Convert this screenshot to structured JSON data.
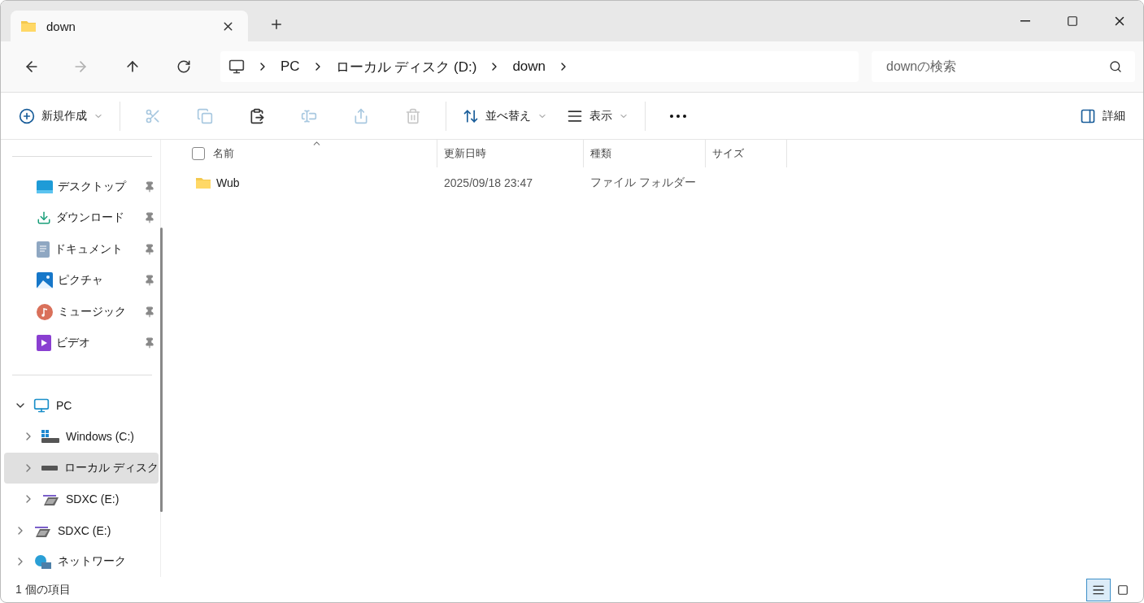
{
  "tabs": [
    {
      "label": "down",
      "selected": true
    }
  ],
  "nav": {
    "back_disabled": false,
    "forward_disabled": true
  },
  "breadcrumb": [
    "PC",
    "ローカル ディスク (D:)",
    "down"
  ],
  "search": {
    "placeholder": "downの検索"
  },
  "toolbar": [
    {
      "kind": "new",
      "label": "新規作成",
      "disabled": false
    },
    {
      "kind": "cut",
      "disabled": true
    },
    {
      "kind": "copy",
      "disabled": true
    },
    {
      "kind": "paste",
      "disabled": false
    },
    {
      "kind": "rename",
      "disabled": true
    },
    {
      "kind": "share",
      "disabled": true
    },
    {
      "kind": "delete",
      "disabled": true
    },
    {
      "kind": "sort",
      "label": "並べ替え",
      "disabled": false
    },
    {
      "kind": "view",
      "label": "表示",
      "disabled": false
    },
    {
      "kind": "more",
      "disabled": false
    }
  ],
  "details_button": {
    "label": "詳細"
  },
  "quick_access": [
    {
      "kind": "desktop",
      "label": "デスクトップ",
      "pinned": true
    },
    {
      "kind": "download",
      "label": "ダウンロード",
      "pinned": true
    },
    {
      "kind": "document",
      "label": "ドキュメント",
      "pinned": true
    },
    {
      "kind": "picture",
      "label": "ピクチャ",
      "pinned": true
    },
    {
      "kind": "music",
      "label": "ミュージック",
      "pinned": true
    },
    {
      "kind": "video",
      "label": "ビデオ",
      "pinned": true
    }
  ],
  "tree": [
    {
      "kind": "pc",
      "label": "PC",
      "expanded": true,
      "selected": false,
      "children": [
        {
          "kind": "windows-drive",
          "label": "Windows (C:)",
          "expanded": false,
          "selected": false
        },
        {
          "kind": "drive",
          "label": "ローカル ディスク",
          "expanded": false,
          "selected": true
        },
        {
          "kind": "sd-card",
          "label": "SDXC (E:)",
          "expanded": false,
          "selected": false
        }
      ]
    },
    {
      "kind": "sd-card",
      "label": "SDXC (E:)",
      "expanded": false,
      "selected": false
    },
    {
      "kind": "network",
      "label": "ネットワーク",
      "expanded": false,
      "selected": false
    }
  ],
  "select_all": {
    "checked": false
  },
  "columns": [
    {
      "label": "名前",
      "sorted": true
    },
    {
      "label": "更新日時",
      "sorted": false
    },
    {
      "label": "種類",
      "sorted": false
    },
    {
      "label": "サイズ",
      "sorted": false
    }
  ],
  "rows": [
    {
      "name": "Wub",
      "modified": "2025/09/18 23:47",
      "type": "ファイル フォルダー",
      "selected": false
    }
  ],
  "status_bar": {
    "text": "1 個の項目"
  },
  "view_modes": [
    {
      "kind": "details",
      "selected": true
    },
    {
      "kind": "tiles",
      "selected": false
    }
  ]
}
